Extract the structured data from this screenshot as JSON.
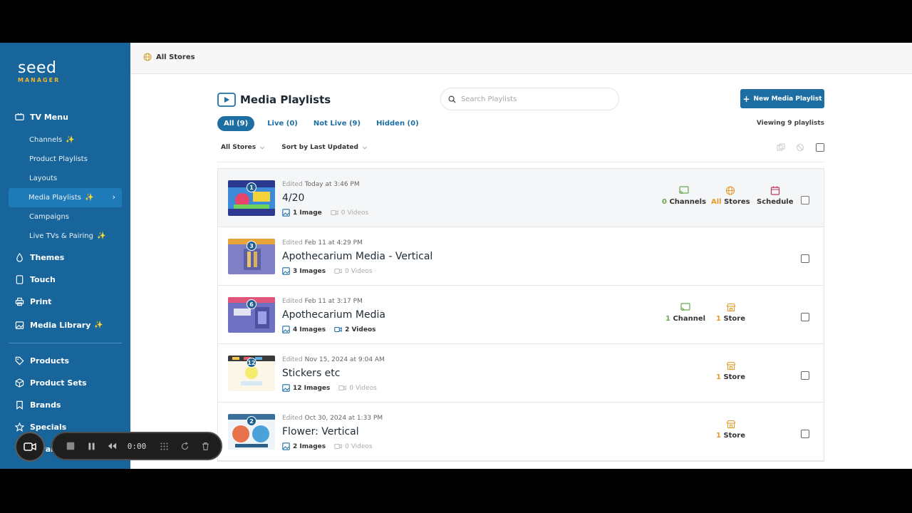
{
  "brand": {
    "name": "seed",
    "sub": "MANAGER"
  },
  "sidebar": {
    "tv_menu": "TV Menu",
    "sub_items": [
      {
        "label": "Channels",
        "spark": true
      },
      {
        "label": "Product Playlists",
        "spark": false
      },
      {
        "label": "Layouts",
        "spark": false
      },
      {
        "label": "Media Playlists",
        "spark": true,
        "active": true
      },
      {
        "label": "Campaigns",
        "spark": false
      },
      {
        "label": "Live TVs & Pairing",
        "spark": true
      }
    ],
    "themes": "Themes",
    "touch": "Touch",
    "print": "Print",
    "media_library": "Media Library",
    "products": "Products",
    "product_sets": "Product Sets",
    "brands": "Brands",
    "specials": "Specials",
    "loyalty": "Loyalty",
    "spark_glyph": "✨"
  },
  "topbar": {
    "store": "All Stores"
  },
  "page": {
    "title": "Media Playlists",
    "search_placeholder": "Search Playlists",
    "new_button": "New Media Playlist",
    "viewing": "Viewing 9 playlists",
    "tabs": [
      "All (9)",
      "Live (0)",
      "Not Live (9)",
      "Hidden (0)"
    ],
    "filter_store": "All Stores",
    "filter_sort": "Sort by Last Updated"
  },
  "labels": {
    "edited": "Edited",
    "channels": "Channels",
    "channel": "Channel",
    "stores": "Stores",
    "store": "Store",
    "all": "All",
    "schedule": "Schedule"
  },
  "playlists": [
    {
      "badge": "1",
      "edited": "Today at 3:46 PM",
      "name": "4/20",
      "images": "1 Image",
      "videos": "0 Videos",
      "videos_active": false
    },
    {
      "badge": "3",
      "edited": "Feb 11 at 4:29 PM",
      "name": "Apothecarium Media - Vertical",
      "images": "3 Images",
      "videos": "0 Videos",
      "videos_active": false
    },
    {
      "badge": "6",
      "edited": "Feb 11 at 3:17 PM",
      "name": "Apothecarium Media",
      "images": "4 Images",
      "videos": "2 Videos",
      "videos_active": true
    },
    {
      "badge": "12",
      "edited": "Nov 15, 2024 at 9:04 AM",
      "name": "Stickers etc",
      "images": "12 Images",
      "videos": "0 Videos",
      "videos_active": false
    },
    {
      "badge": "2",
      "edited": "Oct 30, 2024 at 1:33 PM",
      "name": "Flower: Vertical",
      "images": "2 Images",
      "videos": "0 Videos",
      "videos_active": false
    }
  ],
  "stats": {
    "row0": {
      "channels_n": "0",
      "stores_n": "All"
    },
    "row2": {
      "channels_n": "1",
      "stores_n": "1"
    },
    "row3": {
      "stores_n": "1"
    },
    "row4": {
      "stores_n": "1"
    }
  },
  "recorder": {
    "time": "0:00"
  },
  "colors": {
    "sidebar": "#17659a",
    "primary": "#1d6fa3",
    "green": "#6aa84f",
    "orange": "#e69b2a",
    "schedule": "#c0395a"
  }
}
